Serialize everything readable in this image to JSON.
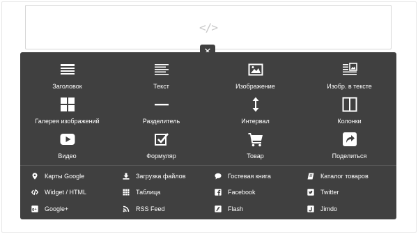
{
  "placeholder": {
    "icon": "code-icon",
    "glyph": "</>"
  },
  "close": {
    "icon": "close-icon",
    "glyph": "✕"
  },
  "tiles": [
    {
      "label": "Заголовок",
      "icon": "heading-icon"
    },
    {
      "label": "Текст",
      "icon": "text-icon"
    },
    {
      "label": "Изображение",
      "icon": "image-icon"
    },
    {
      "label": "Изобр. в тексте",
      "icon": "image-text-icon"
    },
    {
      "label": "Галерея изображений",
      "icon": "gallery-icon"
    },
    {
      "label": "Разделитель",
      "icon": "divider-icon"
    },
    {
      "label": "Интервал",
      "icon": "spacing-icon"
    },
    {
      "label": "Колонки",
      "icon": "columns-icon"
    },
    {
      "label": "Видео",
      "icon": "video-icon"
    },
    {
      "label": "Формуляр",
      "icon": "form-icon"
    },
    {
      "label": "Товар",
      "icon": "cart-icon"
    },
    {
      "label": "Поделиться",
      "icon": "share-icon"
    }
  ],
  "list": [
    {
      "label": "Карты Google",
      "icon": "map-pin-icon"
    },
    {
      "label": "Загрузка файлов",
      "icon": "download-icon"
    },
    {
      "label": "Гостевая книга",
      "icon": "comment-icon"
    },
    {
      "label": "Каталог товаров",
      "icon": "catalog-icon"
    },
    {
      "label": "Widget / HTML",
      "icon": "code-icon"
    },
    {
      "label": "Таблица",
      "icon": "table-icon"
    },
    {
      "label": "Facebook",
      "icon": "facebook-icon"
    },
    {
      "label": "Twitter",
      "icon": "twitter-icon"
    },
    {
      "label": "Google+",
      "icon": "google-plus-icon"
    },
    {
      "label": "RSS Feed",
      "icon": "rss-icon"
    },
    {
      "label": "Flash",
      "icon": "flash-icon"
    },
    {
      "label": "Jimdo",
      "icon": "jimdo-icon"
    }
  ],
  "colors": {
    "panel": "#404040",
    "text": "#ffffff",
    "icon": "#ffffff",
    "divider": "#585858"
  }
}
